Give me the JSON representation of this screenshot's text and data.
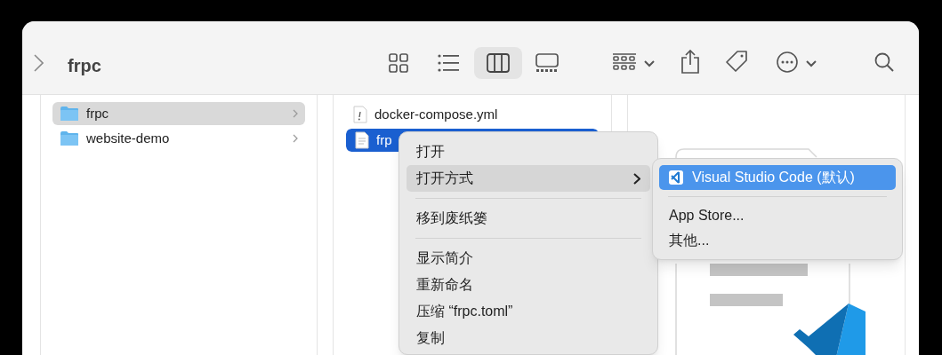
{
  "window": {
    "title": "frpc"
  },
  "toolbar": {
    "view_modes": [
      {
        "kind": "icons",
        "selected": false
      },
      {
        "kind": "list",
        "selected": false
      },
      {
        "kind": "columns",
        "selected": true
      },
      {
        "kind": "gallery",
        "selected": false
      }
    ]
  },
  "columns": [
    {
      "items": [
        {
          "name": "frpc",
          "kind": "folder",
          "selected": true
        },
        {
          "name": "website-demo",
          "kind": "folder",
          "selected": false
        }
      ]
    },
    {
      "items": [
        {
          "name": "docker-compose.yml",
          "kind": "yaml",
          "selected": false
        },
        {
          "name": "frp",
          "kind": "text",
          "selected": true
        }
      ]
    }
  ],
  "context_menu": {
    "items": [
      {
        "kind": "item",
        "label": "打开",
        "highlighted": false,
        "submenu": false
      },
      {
        "kind": "item",
        "label": "打开方式",
        "highlighted": true,
        "submenu": true
      },
      {
        "kind": "separator"
      },
      {
        "kind": "item",
        "label": "移到废纸篓",
        "highlighted": false,
        "submenu": false
      },
      {
        "kind": "separator"
      },
      {
        "kind": "item",
        "label": "显示简介",
        "highlighted": false,
        "submenu": false
      },
      {
        "kind": "item",
        "label": "重新命名",
        "highlighted": false,
        "submenu": false
      },
      {
        "kind": "item",
        "label": "压缩 “frpc.toml”",
        "highlighted": false,
        "submenu": false
      },
      {
        "kind": "item",
        "label": "复制",
        "highlighted": false,
        "submenu": false
      }
    ]
  },
  "submenu": {
    "items": [
      {
        "kind": "app",
        "label": "Visual Studio Code (默认)",
        "highlighted": true
      },
      {
        "kind": "separator"
      },
      {
        "kind": "item",
        "label": "App Store...",
        "highlighted": false
      },
      {
        "kind": "item",
        "label": "其他...",
        "highlighted": false
      }
    ]
  }
}
